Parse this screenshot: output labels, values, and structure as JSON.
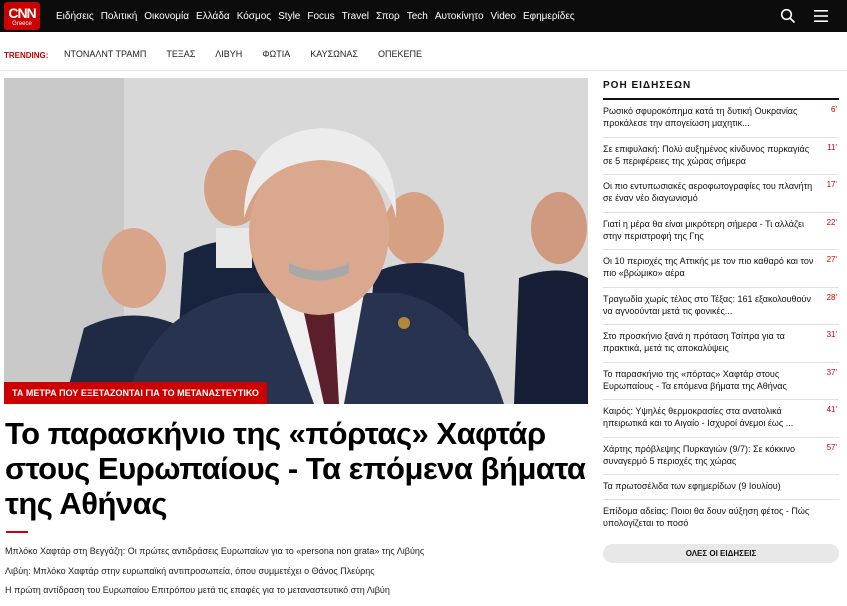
{
  "brand": {
    "logo_text": "CNN",
    "logo_sub": "Greece",
    "accent": "#cc0000"
  },
  "nav": {
    "items": [
      "Ειδήσεις",
      "Πολιτική",
      "Οικονομία",
      "Ελλάδα",
      "Κόσμος",
      "Style",
      "Focus",
      "Travel",
      "Σπορ",
      "Tech",
      "Αυτοκίνητο",
      "Video",
      "Εφημερίδες"
    ],
    "icons": [
      "search-icon",
      "menu-icon"
    ]
  },
  "trending": {
    "label": "TRENDING:",
    "items": [
      "ΝΤΟΝΑΛΝΤ ΤΡΑΜΠ",
      "ΤΕΞΑΣ",
      "ΛΙΒΥΗ",
      "ΦΩΤΙΑ",
      "ΚΑΥΣΩΝΑΣ",
      "ΟΠΕΚΕΠΕ"
    ]
  },
  "hero": {
    "tag": "ΤΑ ΜΕΤΡΑ ΠΟΥ ΕΞΕΤΑΖΟΝΤΑΙ ΓΙΑ ΤΟ ΜΕΤΑΝΑΣΤΕΥΤΙΚΟ",
    "headline": "Το παρασκήνιο της «πόρτας» Χαφτάρ στους Ευρωπαίους - Τα επόμενα βήματα της Αθήνας",
    "related": [
      "Μπλόκο Χαφτάρ στη Βεγγάζη: Οι πρώτες αντιδράσεις Ευρωπαίων για το «persona non grata» της Λιβύης",
      "Λιβύη: Μπλόκο Χαφτάρ στην ευρωπαϊκή αντιπροσωπεία, όπου συμμετέχει ο Θάνος Πλεύρης",
      "Η πρώτη αντίδραση του Ευρωπαίου Επιτρόπου μετά τις επαφές για το μεταναστευτικό στη Λιβύη"
    ]
  },
  "sidebar": {
    "title": "ΡΟΗ ΕΙΔΗΣΕΩΝ",
    "items": [
      {
        "text": "Ρωσικό σφυροκόπημα κατά τη δυτική Ουκρανίας προκάλεσε την απογείωση μαχητικ...",
        "min": "6'"
      },
      {
        "text": "Σε επιφυλακή: Πολύ αυξημένος κίνδυνος πυρκαγιάς σε 5 περιφέρειες της χώρας σήμερα",
        "min": "11'"
      },
      {
        "text": "Οι πιο εντυπωσιακές αεροφωτογραφίες του πλανήτη σε έναν νέο διαγωνισμό",
        "min": "17'"
      },
      {
        "text": "Γιατί η μέρα θα είναι μικρότερη σήμερα - Τι αλλάζει στην περιστροφή της Γης",
        "min": "22'"
      },
      {
        "text": "Οι 10 περιοχές της Αττικής με τον πιο καθαρό και τον πιο «βρώμικο» αέρα",
        "min": "27'"
      },
      {
        "text": "Τραγωδία χωρίς τέλος στο Τέξας: 161 εξακολουθούν να αγνοούνται μετά τις φονικές...",
        "min": "28'"
      },
      {
        "text": "Στο προσκήνιο ξανά η πρόταση Τσίπρα για τα πρακτικά, μετά τις αποκαλύψεις",
        "min": "31'"
      },
      {
        "text": "Το παρασκήνιο της «πόρτας» Χαφτάρ στους Ευρωπαίους - Τα επόμενα βήματα της Αθήνας",
        "min": "37'"
      },
      {
        "text": "Καιρός: Υψηλές θερμοκρασίες στα ανατολικά ηπειρωτικά και το Αιγαίο - Ισχυροί άνεμοι έως ...",
        "min": "41'"
      },
      {
        "text": "Χάρτης πρόβλεψης Πυρκαγιών (9/7): Σε κόκκινο συναγερμό 5 περιοχές της χώρας",
        "min": "57'"
      },
      {
        "text": "Τα πρωτοσέλιδα των εφημερίδων (9 Ιουλίου)",
        "min": ""
      },
      {
        "text": "Επίδομα αδείας: Ποιοι θα δουν αύξηση φέτος - Πώς υπολογίζεται το ποσό",
        "min": ""
      }
    ],
    "all_news_label": "ΟΛΕΣ ΟΙ ΕΙΔΗΣΕΙΣ"
  }
}
